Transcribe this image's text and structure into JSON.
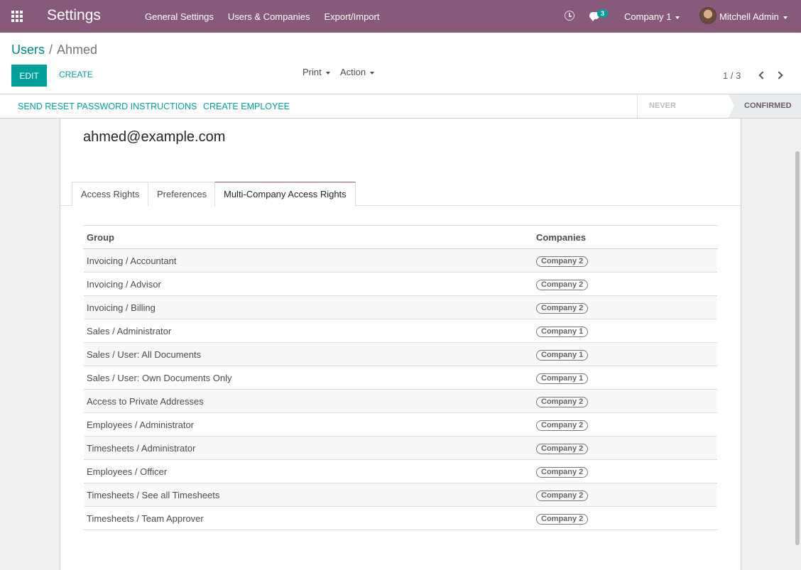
{
  "navbar": {
    "brand": "Settings",
    "menu": [
      "General Settings",
      "Users & Companies",
      "Export/Import"
    ],
    "chat_count": "3",
    "company": "Company 1",
    "user": "Mitchell Admin"
  },
  "breadcrumb": {
    "parent": "Users",
    "separator": "/",
    "current": "Ahmed"
  },
  "toolbar": {
    "edit": "EDIT",
    "create": "CREATE",
    "print": "Print",
    "action": "Action"
  },
  "pager": {
    "value": "1 / 3"
  },
  "statusbar": {
    "actions": [
      "SEND RESET PASSWORD INSTRUCTIONS",
      "CREATE EMPLOYEE"
    ],
    "steps": [
      "NEVER CONNECTED",
      "CONFIRMED"
    ]
  },
  "record": {
    "email": "ahmed@example.com"
  },
  "tabs": [
    "Access Rights",
    "Preferences",
    "Multi-Company Access Rights"
  ],
  "table": {
    "headers": [
      "Group",
      "Companies"
    ],
    "rows": [
      {
        "group": "Invoicing / Accountant",
        "company": "Company 2"
      },
      {
        "group": "Invoicing / Advisor",
        "company": "Company 2"
      },
      {
        "group": "Invoicing / Billing",
        "company": "Company 2"
      },
      {
        "group": "Sales / Administrator",
        "company": "Company 1"
      },
      {
        "group": "Sales / User: All Documents",
        "company": "Company 1"
      },
      {
        "group": "Sales / User: Own Documents Only",
        "company": "Company 1"
      },
      {
        "group": "Access to Private Addresses",
        "company": "Company 2"
      },
      {
        "group": "Employees / Administrator",
        "company": "Company 2"
      },
      {
        "group": "Timesheets / Administrator",
        "company": "Company 2"
      },
      {
        "group": "Employees / Officer",
        "company": "Company 2"
      },
      {
        "group": "Timesheets / See all Timesheets",
        "company": "Company 2"
      },
      {
        "group": "Timesheets / Team Approver",
        "company": "Company 2"
      }
    ]
  },
  "colors": {
    "brand": "#875a7b",
    "accent": "#00a09d"
  }
}
